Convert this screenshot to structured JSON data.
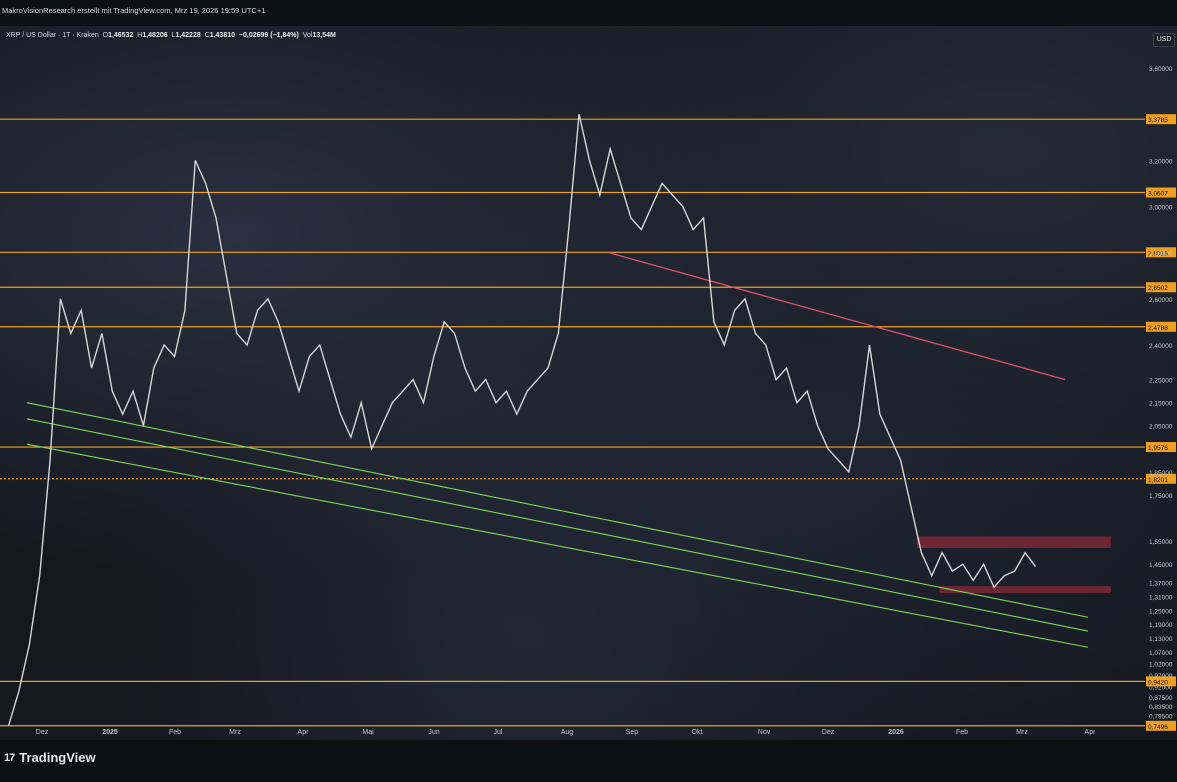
{
  "header": {
    "credit": "MakroVisionResearch erstellt mit TradingView.com, Mrz 19, 2026 19:59 UTC+1"
  },
  "legend": {
    "symbol": "XRP / US Dollar · 1T · Kraken",
    "o_label": "O",
    "o_value": "1,46532",
    "h_label": "H",
    "h_value": "1,48206",
    "l_label": "L",
    "l_value": "1,42228",
    "c_label": "C",
    "c_value": "1,43810",
    "change": "−0,02699 (−1,84%)",
    "vol_label": "Vol",
    "vol_value": "13,54M"
  },
  "currency_button": "USD",
  "brand": {
    "mark": "17",
    "name": "TradingView"
  },
  "colors": {
    "price": "#d6d6d6",
    "level": "#f0a020",
    "trend_red": "#e0506a",
    "channel_green": "#7ed957",
    "zone": "#8a2a38",
    "axis_text": "#bfc3ca"
  },
  "chart_data": {
    "type": "line",
    "x_ticks": [
      "Dez",
      "2025",
      "Feb",
      "Mrz",
      "Apr",
      "Mai",
      "Jun",
      "Jul",
      "Aug",
      "Sep",
      "Okt",
      "Nov",
      "Dez",
      "2026",
      "Feb",
      "Mrz",
      "Apr"
    ],
    "y_ticks": [
      "3,60000",
      "3,20000",
      "3,00000",
      "2,80000",
      "2,60000",
      "2,40000",
      "2,25000",
      "2,15000",
      "2,05000",
      "1,85000",
      "1,75000",
      "1,55000",
      "1,45000",
      "1,37000",
      "1,31000",
      "1,25000",
      "1,19000",
      "1,13000",
      "1,07000",
      "1,02000",
      "0,97000",
      "0,92000",
      "0,87500",
      "0,83500",
      "0,79500"
    ],
    "levels": [
      {
        "label": "3,3785",
        "value": 3.3785
      },
      {
        "label": "3,0607",
        "value": 3.0607
      },
      {
        "label": "2,8016",
        "value": 2.8016
      },
      {
        "label": "2,6502",
        "value": 2.6502
      },
      {
        "label": "2,4788",
        "value": 2.4788
      },
      {
        "label": "1,9576",
        "value": 1.9576
      },
      {
        "label": "1,8201",
        "value": 1.8201
      },
      {
        "label": "0,9420",
        "value": 0.942
      },
      {
        "label": "0,7496",
        "value": 0.7496
      }
    ],
    "series": [
      {
        "values": [
          0.75,
          0.9,
          1.1,
          1.4,
          1.9,
          2.6,
          2.45,
          2.55,
          2.3,
          2.45,
          2.2,
          2.1,
          2.2,
          2.05,
          2.3,
          2.4,
          2.35,
          2.55,
          3.2,
          3.1,
          2.95,
          2.7,
          2.45,
          2.4,
          2.55,
          2.6,
          2.5,
          2.35,
          2.2,
          2.35,
          2.4,
          2.25,
          2.1,
          2.0,
          2.15,
          1.95,
          2.05,
          2.15,
          2.2,
          2.25,
          2.15,
          2.35,
          2.5,
          2.45,
          2.3,
          2.2,
          2.25,
          2.15,
          2.2,
          2.1,
          2.2,
          2.25,
          2.3,
          2.45,
          2.9,
          3.4,
          3.2,
          3.05,
          3.25,
          3.1,
          2.95,
          2.9,
          3.0,
          3.1,
          3.05,
          3.0,
          2.9,
          2.95,
          2.5,
          2.4,
          2.55,
          2.6,
          2.45,
          2.4,
          2.25,
          2.3,
          2.15,
          2.2,
          2.05,
          1.95,
          1.9,
          1.85,
          2.05,
          2.4,
          2.1,
          2.0,
          1.9,
          1.7,
          1.5,
          1.4,
          1.5,
          1.42,
          1.45,
          1.38,
          1.45,
          1.35,
          1.4,
          1.42,
          1.5,
          1.44
        ]
      }
    ],
    "trendline_red": [
      [
        0.53,
        2.8
      ],
      [
        0.93,
        2.25
      ]
    ],
    "channels_green": [
      [
        [
          0.02,
          2.15
        ],
        [
          0.95,
          1.22
        ]
      ],
      [
        [
          0.02,
          2.08
        ],
        [
          0.95,
          1.16
        ]
      ],
      [
        [
          0.02,
          1.97
        ],
        [
          0.95,
          1.09
        ]
      ]
    ],
    "zones": [
      {
        "x0": 0.8,
        "x1": 0.97,
        "y0": 1.52,
        "y1": 1.57
      },
      {
        "x0": 0.82,
        "x1": 0.97,
        "y0": 1.325,
        "y1": 1.355
      }
    ],
    "y_range": [
      0.74,
      3.7
    ]
  }
}
